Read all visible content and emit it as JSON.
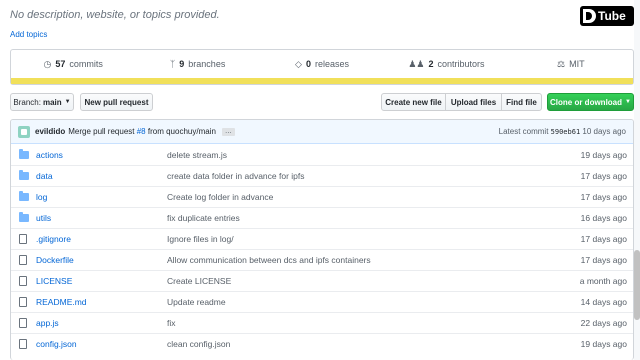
{
  "repo": {
    "description": "No description, website, or topics provided.",
    "add_topics": "Add topics"
  },
  "watermark": "Tube",
  "stats": {
    "commits": {
      "count": "57",
      "label": "commits"
    },
    "branches": {
      "count": "9",
      "label": "branches"
    },
    "releases": {
      "count": "0",
      "label": "releases"
    },
    "contributors": {
      "count": "2",
      "label": "contributors"
    },
    "license": "MIT",
    "language_color": "#f1e05a"
  },
  "toolbar": {
    "branch_prefix": "Branch:",
    "branch_name": "main",
    "new_pull_request": "New pull request",
    "create_new_file": "Create new file",
    "upload_files": "Upload files",
    "find_file": "Find file",
    "clone_or_download": "Clone or download"
  },
  "latest_commit": {
    "author": "evildido",
    "message_pre": "Merge pull request",
    "pr_number": "#8",
    "message_post": "from quochuy/main",
    "ellipsis": "…",
    "label": "Latest commit",
    "sha": "590eb61",
    "age": "10 days ago"
  },
  "files": [
    {
      "name": "actions",
      "type": "folder",
      "message": "delete stream.js",
      "age": "19 days ago"
    },
    {
      "name": "data",
      "type": "folder",
      "message": "create data folder in advance for ipfs",
      "age": "17 days ago"
    },
    {
      "name": "log",
      "type": "folder",
      "message": "Create log folder in advance",
      "age": "17 days ago"
    },
    {
      "name": "utils",
      "type": "folder",
      "message": "fix duplicate entries",
      "age": "16 days ago"
    },
    {
      "name": ".gitignore",
      "type": "file",
      "message": "Ignore files in log/",
      "age": "17 days ago"
    },
    {
      "name": "Dockerfile",
      "type": "file",
      "message": "Allow communication between dcs and ipfs containers",
      "age": "17 days ago"
    },
    {
      "name": "LICENSE",
      "type": "file",
      "message": "Create LICENSE",
      "age": "a month ago"
    },
    {
      "name": "README.md",
      "type": "file",
      "message": "Update readme",
      "age": "14 days ago"
    },
    {
      "name": "app.js",
      "type": "file",
      "message": "fix",
      "age": "22 days ago"
    },
    {
      "name": "config.json",
      "type": "file",
      "message": "clean config.json",
      "age": "19 days ago"
    }
  ]
}
